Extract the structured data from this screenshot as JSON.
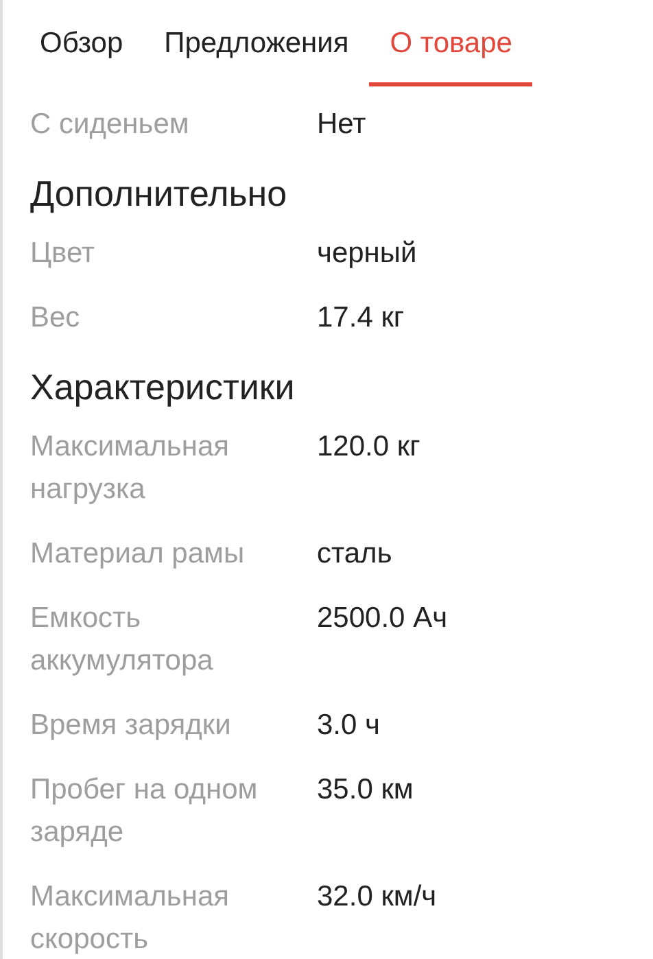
{
  "tabs": [
    {
      "label": "Обзор",
      "selected": false
    },
    {
      "label": "Предложения",
      "selected": false
    },
    {
      "label": "О товаре",
      "selected": true
    }
  ],
  "sections": [
    {
      "rows": [
        {
          "label": "С сиденьем",
          "value": "Нет"
        }
      ]
    },
    {
      "title": "Дополнительно",
      "rows": [
        {
          "label": "Цвет",
          "value": "черный"
        },
        {
          "label": "Вес",
          "value": "17.4 кг"
        }
      ]
    },
    {
      "title": "Характеристики",
      "rows": [
        {
          "label": "Максимальная нагрузка",
          "value": "120.0 кг"
        },
        {
          "label": "Материал рамы",
          "value": "сталь"
        },
        {
          "label": "Емкость аккумулятора",
          "value": "2500.0 Ач"
        },
        {
          "label": "Время зарядки",
          "value": "3.0 ч"
        },
        {
          "label": "Пробег на одном заряде",
          "value": "35.0 км"
        },
        {
          "label": "Максимальная скорость",
          "value": "32.0 км/ч"
        }
      ]
    }
  ]
}
